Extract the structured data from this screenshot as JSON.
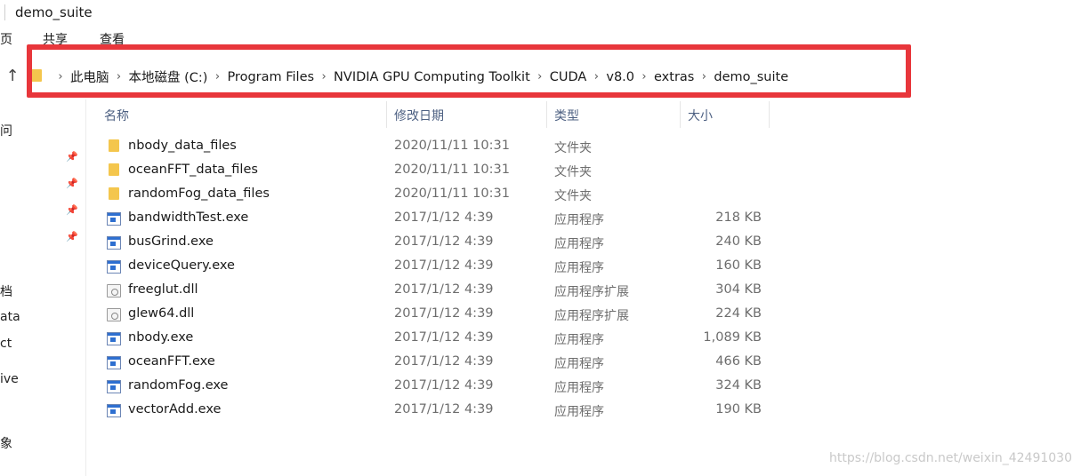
{
  "window": {
    "title": "demo_suite"
  },
  "ribbon": {
    "tabs": [
      "页",
      "共享",
      "查看"
    ]
  },
  "address": {
    "crumbs": [
      "此电脑",
      "本地磁盘 (C:)",
      "Program Files",
      "NVIDIA GPU Computing Toolkit",
      "CUDA",
      "v8.0",
      "extras",
      "demo_suite"
    ],
    "highlight_color": "#e8363b"
  },
  "nav": {
    "fragments": [
      "问",
      "档",
      "ata",
      "ct",
      "ive",
      "象"
    ]
  },
  "columns": {
    "name": "名称",
    "date": "修改日期",
    "type": "类型",
    "size": "大小"
  },
  "files": [
    {
      "name": "nbody_data_files",
      "date": "2020/11/11 10:31",
      "type": "文件夹",
      "size": "",
      "icon": "folder-icon"
    },
    {
      "name": "oceanFFT_data_files",
      "date": "2020/11/11 10:31",
      "type": "文件夹",
      "size": "",
      "icon": "folder-icon"
    },
    {
      "name": "randomFog_data_files",
      "date": "2020/11/11 10:31",
      "type": "文件夹",
      "size": "",
      "icon": "folder-icon"
    },
    {
      "name": "bandwidthTest.exe",
      "date": "2017/1/12 4:39",
      "type": "应用程序",
      "size": "218 KB",
      "icon": "exe-icon"
    },
    {
      "name": "busGrind.exe",
      "date": "2017/1/12 4:39",
      "type": "应用程序",
      "size": "240 KB",
      "icon": "exe-icon"
    },
    {
      "name": "deviceQuery.exe",
      "date": "2017/1/12 4:39",
      "type": "应用程序",
      "size": "160 KB",
      "icon": "exe-icon"
    },
    {
      "name": "freeglut.dll",
      "date": "2017/1/12 4:39",
      "type": "应用程序扩展",
      "size": "304 KB",
      "icon": "dll-icon"
    },
    {
      "name": "glew64.dll",
      "date": "2017/1/12 4:39",
      "type": "应用程序扩展",
      "size": "224 KB",
      "icon": "dll-icon"
    },
    {
      "name": "nbody.exe",
      "date": "2017/1/12 4:39",
      "type": "应用程序",
      "size": "1,089 KB",
      "icon": "exe-icon"
    },
    {
      "name": "oceanFFT.exe",
      "date": "2017/1/12 4:39",
      "type": "应用程序",
      "size": "466 KB",
      "icon": "exe-icon"
    },
    {
      "name": "randomFog.exe",
      "date": "2017/1/12 4:39",
      "type": "应用程序",
      "size": "324 KB",
      "icon": "exe-icon"
    },
    {
      "name": "vectorAdd.exe",
      "date": "2017/1/12 4:39",
      "type": "应用程序",
      "size": "190 KB",
      "icon": "exe-icon"
    }
  ],
  "watermark": "https://blog.csdn.net/weixin_42491030"
}
